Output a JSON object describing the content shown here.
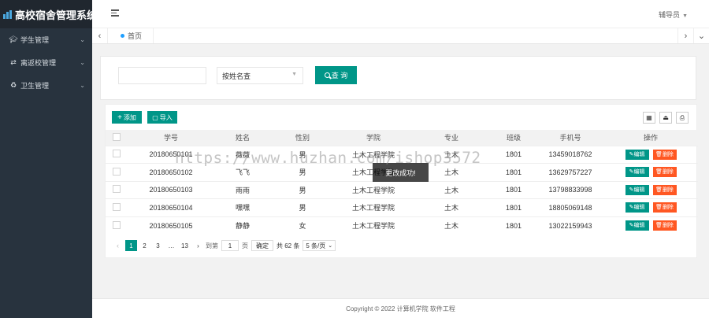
{
  "app": {
    "title": "高校宿舍管理系统"
  },
  "sidebar": {
    "items": [
      {
        "label": "学生管理",
        "icon": "graduation-cap-icon"
      },
      {
        "label": "离返校管理",
        "icon": "exchange-icon"
      },
      {
        "label": "卫生管理",
        "icon": "recycle-icon"
      }
    ]
  },
  "header": {
    "user": "辅导员"
  },
  "tabs": {
    "home": "首页"
  },
  "search": {
    "input_value": "",
    "select_value": "按姓名查",
    "button": "查 询"
  },
  "toolbar": {
    "add": "添加",
    "import": "导入"
  },
  "table": {
    "columns": [
      "学号",
      "姓名",
      "性别",
      "学院",
      "专业",
      "班级",
      "手机号",
      "操作"
    ],
    "rows": [
      {
        "id": "20180650101",
        "name": "薇薇",
        "gender": "男",
        "college": "土木工程学院",
        "major": "土木",
        "class": "1801",
        "phone": "13459018762"
      },
      {
        "id": "20180650102",
        "name": "飞飞",
        "gender": "男",
        "college": "土木工程学院",
        "major": "土木",
        "class": "1801",
        "phone": "13629757227"
      },
      {
        "id": "20180650103",
        "name": "雨雨",
        "gender": "男",
        "college": "土木工程学院",
        "major": "土木",
        "class": "1801",
        "phone": "13798833998"
      },
      {
        "id": "20180650104",
        "name": "嘿嘿",
        "gender": "男",
        "college": "土木工程学院",
        "major": "土木",
        "class": "1801",
        "phone": "18805069148"
      },
      {
        "id": "20180650105",
        "name": "静静",
        "gender": "女",
        "college": "土木工程学院",
        "major": "土木",
        "class": "1801",
        "phone": "13022159943"
      }
    ],
    "edit_label": "编辑",
    "delete_label": "删除"
  },
  "pager": {
    "pages": [
      "1",
      "2",
      "3",
      "…",
      "13"
    ],
    "goto_label": "到第",
    "goto_value": "1",
    "page_unit": "页",
    "confirm": "确定",
    "total": "共 62 条",
    "size": "5 条/页"
  },
  "toast": "更改成功!",
  "watermark": "https://www.huzhan.com/ishop3572",
  "footer": "Copyright © 2022 计算机学院 软件工程",
  "colors": {
    "primary": "#009688",
    "danger": "#ff5722",
    "sidebar": "#28333e"
  }
}
